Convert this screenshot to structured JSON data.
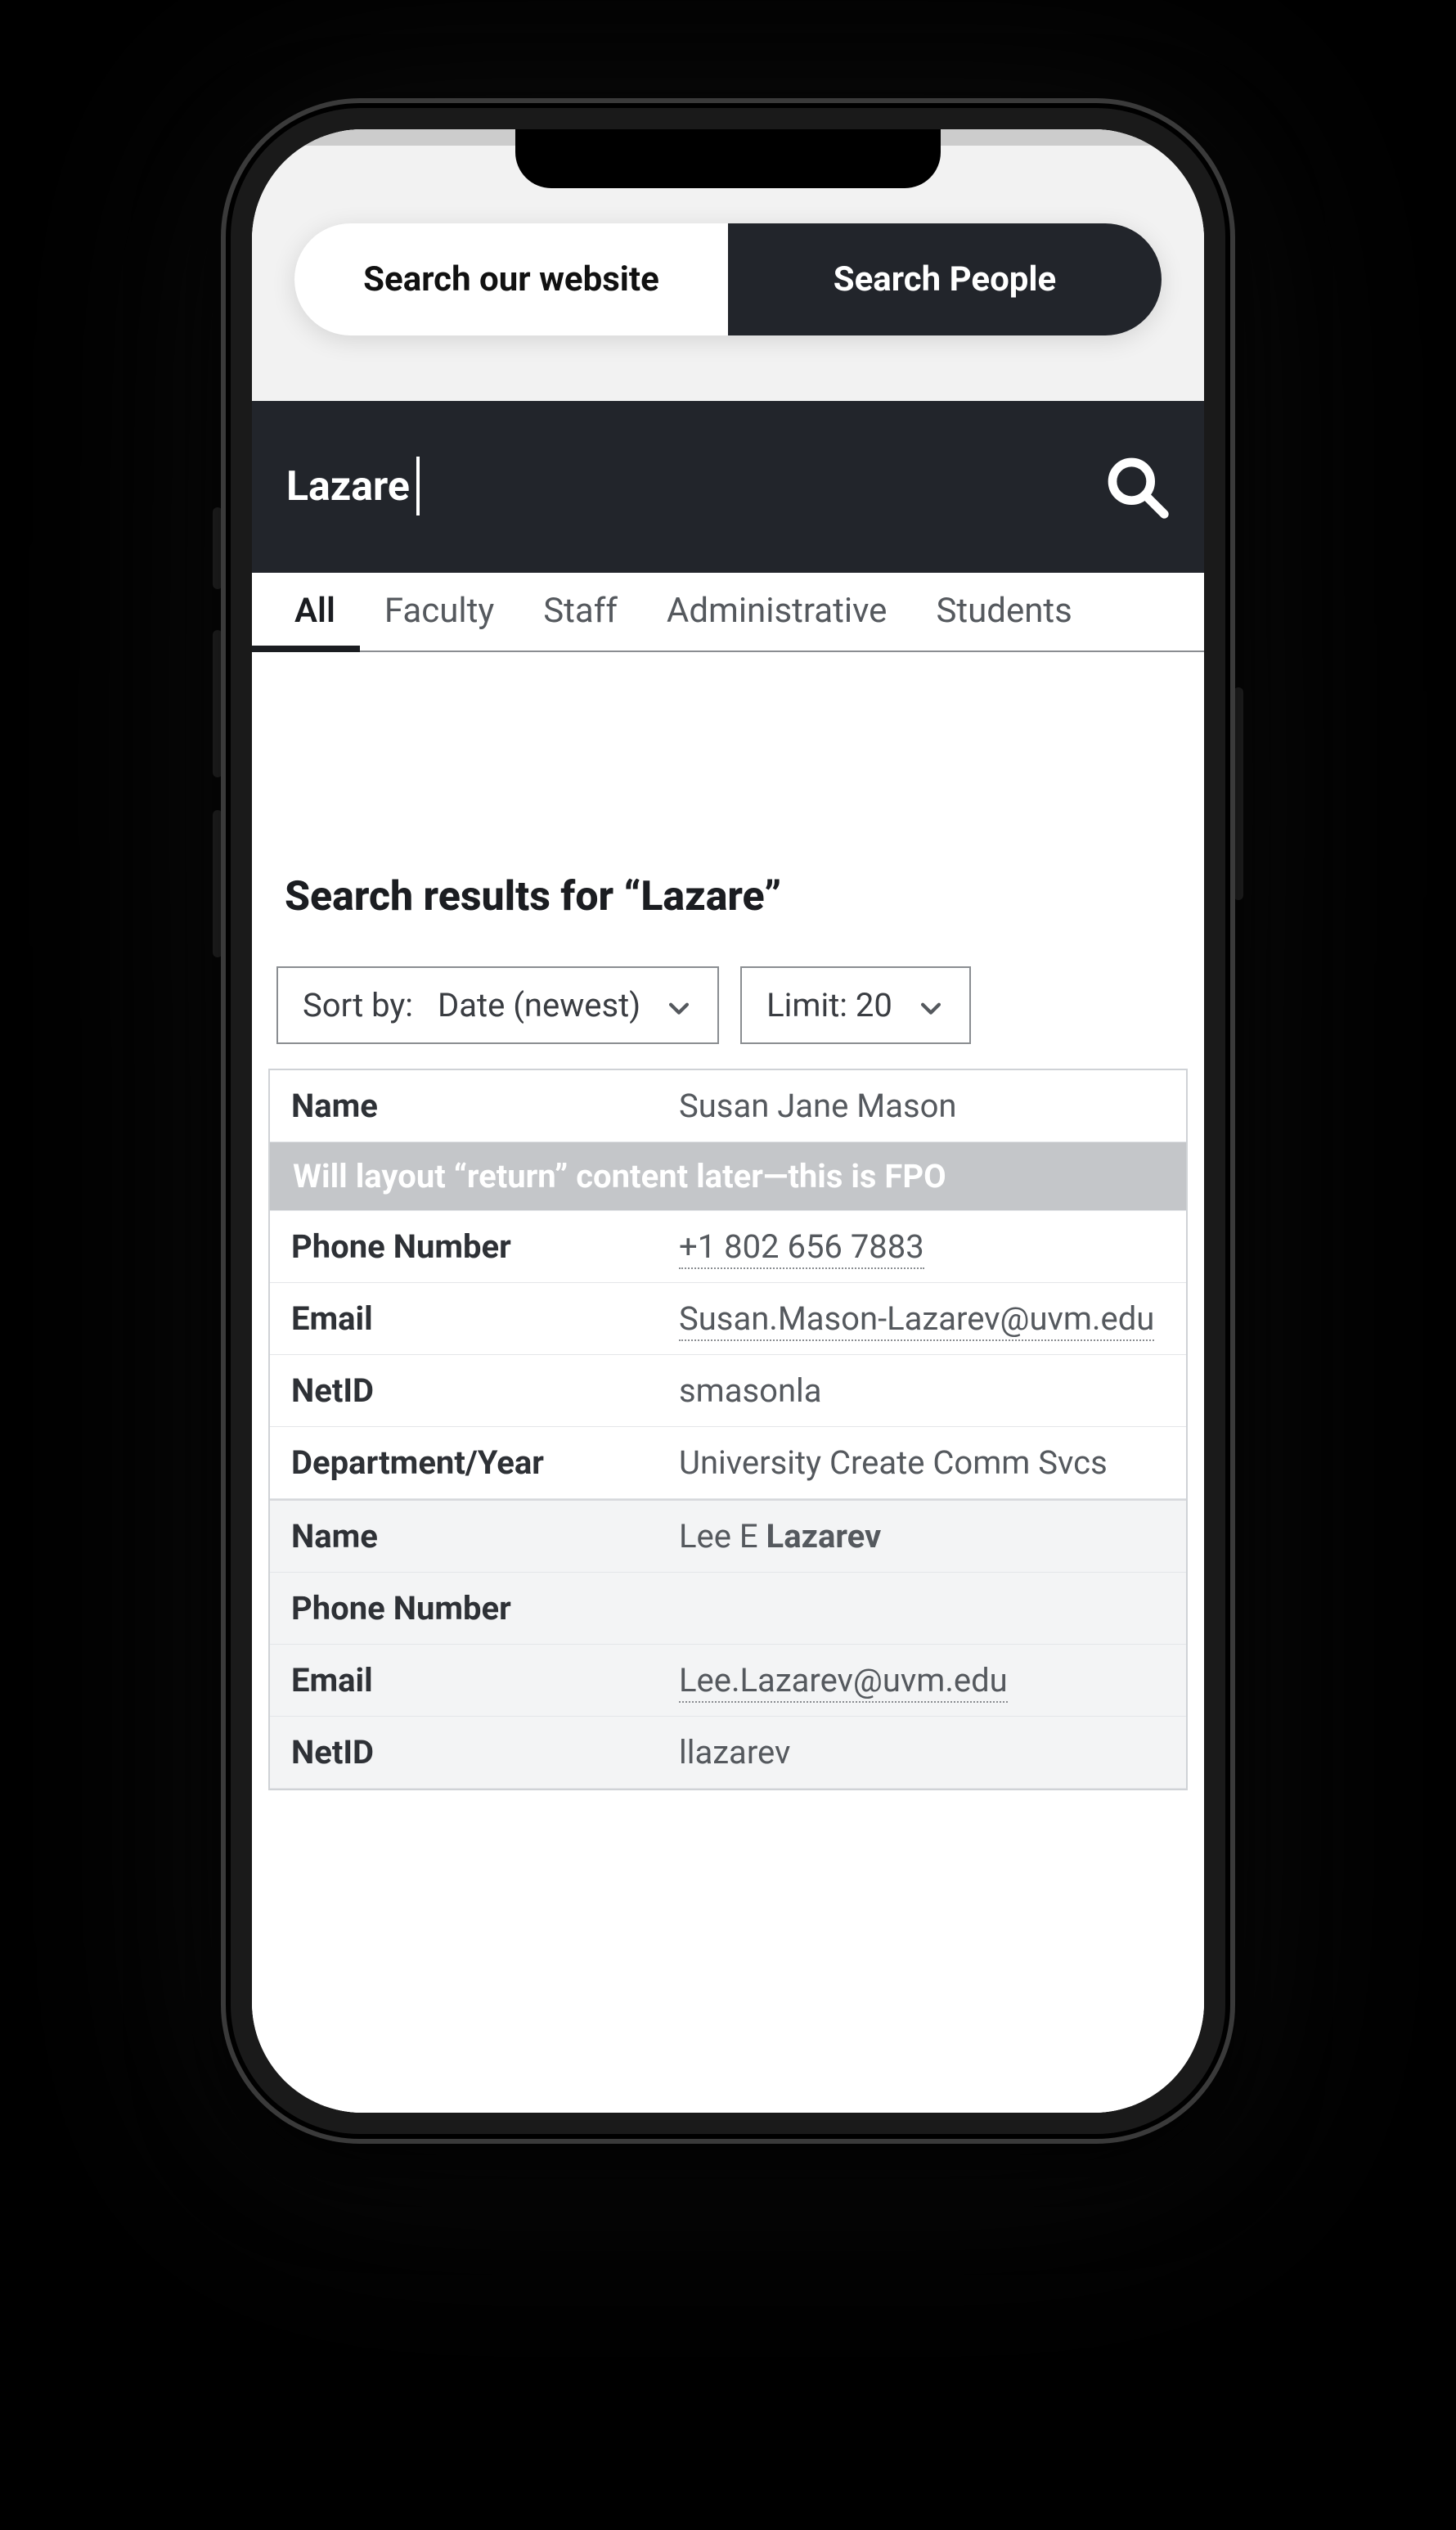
{
  "pill": {
    "left": "Search our website",
    "right": "Search People"
  },
  "search": {
    "query": "Lazare"
  },
  "tabs": [
    "All",
    "Faculty",
    "Staff",
    "Administrative",
    "Students"
  ],
  "heading": "Search results for “Lazare”",
  "sort": {
    "prefix": "Sort by:",
    "value": "Date (newest)"
  },
  "limit": {
    "label": "Limit: 20"
  },
  "labels": {
    "name": "Name",
    "phone": "Phone Number",
    "email": "Email",
    "netid": "NetID",
    "dept": "Department/Year"
  },
  "fpo": "Will layout “return” content later—this is FPO",
  "results": [
    {
      "name": "Susan Jane Mason",
      "phone": "+1 802 656 7883",
      "email": "Susan.Mason-Lazarev@uvm.edu",
      "netid": "smasonla",
      "dept": "University Create Comm Svcs"
    },
    {
      "name_pre": "Lee E ",
      "name_bold": "Lazarev",
      "phone": "",
      "email": "Lee.Lazarev@uvm.edu",
      "netid": "llazarev"
    }
  ]
}
